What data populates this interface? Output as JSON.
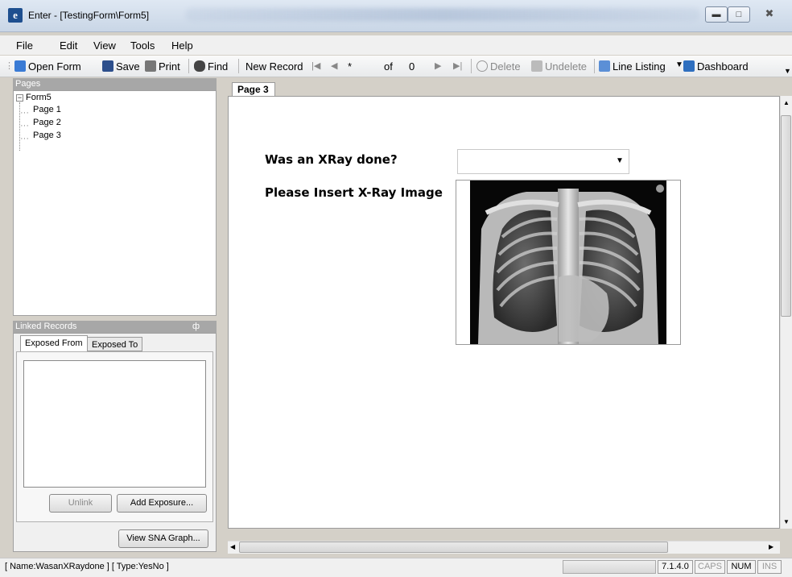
{
  "window": {
    "title": "Enter - [TestingForm\\Form5]",
    "app_icon_letter": "e"
  },
  "menu": [
    "File",
    "Edit",
    "View",
    "Tools",
    "Help"
  ],
  "toolbar": {
    "open_form": "Open Form",
    "save": "Save",
    "print": "Print",
    "find": "Find",
    "new_record": "New Record",
    "record_current": "*",
    "of_label": "of",
    "record_total": "0",
    "delete": "Delete",
    "undelete": "Undelete",
    "line_listing": "Line Listing",
    "dashboard": "Dashboard"
  },
  "pages_panel": {
    "header": "Pages",
    "root": "Form5",
    "items": [
      "Page 1",
      "Page 2",
      "Page 3"
    ]
  },
  "linked_records": {
    "header": "Linked Records",
    "pin": "ф",
    "tabs": [
      "Exposed From",
      "Exposed To"
    ],
    "unlink": "Unlink",
    "add_exposure": "Add Exposure...",
    "view_sna": "View SNA Graph..."
  },
  "content": {
    "tab": "Page 3",
    "question_xray": "Was an XRay done?",
    "question_image": "Please Insert X-Ray Image",
    "xray_value": ""
  },
  "status": {
    "text": "[ Name:WasanXRaydone ] [ Type:YesNo ]",
    "version": "7.1.4.0",
    "caps": "CAPS",
    "num": "NUM",
    "ins": "INS"
  }
}
